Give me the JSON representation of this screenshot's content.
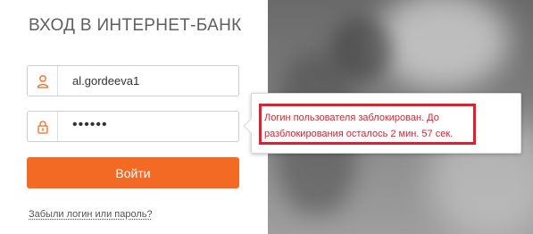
{
  "title": "ВХОД В ИНТЕРНЕТ-БАНК",
  "login_field": {
    "icon": "user-icon",
    "value": "al.gordeeva1"
  },
  "password_field": {
    "icon": "lock-icon",
    "value": "••••••"
  },
  "login_button": {
    "label": "Войти"
  },
  "forgot_link": {
    "label": "Забыли логин или пароль?"
  },
  "error_tooltip": {
    "message": "Логин пользователя заблокирован. До разблокирования осталось 2 мин. 57 сек."
  },
  "colors": {
    "accent": "#f26a24",
    "error": "#e0202f",
    "title": "#5f5f5f"
  }
}
